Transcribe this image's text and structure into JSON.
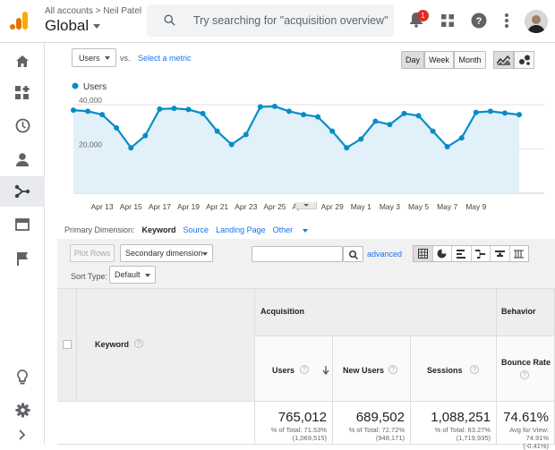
{
  "header": {
    "breadcrumb": "All accounts > Neil Patel",
    "property": "Global",
    "search_placeholder": "Try searching for \"acquisition overview\"",
    "notification_count": "1"
  },
  "sidebar": {
    "items": [
      "home-icon",
      "dashboard-icon",
      "realtime-icon",
      "audience-icon",
      "acquisition-icon",
      "behavior-icon",
      "conversions-icon",
      "discover-icon",
      "admin-icon",
      "expand-icon"
    ],
    "active": "acquisition-icon"
  },
  "controls": {
    "metric_select": "Users",
    "vs": "vs.",
    "select_metric": "Select a metric",
    "day": "Day",
    "week": "Week",
    "month": "Month"
  },
  "chart_data": {
    "type": "area",
    "series": [
      {
        "name": "Users",
        "values": [
          37500,
          37000,
          35500,
          29500,
          20500,
          26000,
          38000,
          38300,
          37800,
          36000,
          28000,
          22000,
          26500,
          39000,
          39200,
          37000,
          35500,
          34500,
          28000,
          20500,
          24500,
          32500,
          31000,
          36000,
          35000,
          28000,
          21000,
          25000,
          36500,
          37000,
          36200,
          35500
        ]
      }
    ],
    "x_tick_labels": [
      "Apr 13",
      "Apr 15",
      "Apr 17",
      "Apr 19",
      "Apr 21",
      "Apr 23",
      "Apr 25",
      "Apr 27",
      "Apr 29",
      "May 1",
      "May 3",
      "May 5",
      "May 7",
      "May 9"
    ],
    "y_tick_labels": [
      "40,000",
      "20,000"
    ],
    "ylim": [
      0,
      42000
    ],
    "color": "#058dc7",
    "fill": "#e1f0f9"
  },
  "dimensions": {
    "label": "Primary Dimension:",
    "keyword": "Keyword",
    "source": "Source",
    "landing": "Landing Page",
    "other": "Other"
  },
  "tools": {
    "plot_rows": "Plot Rows",
    "secondary": "Secondary dimension",
    "sort_type_label": "Sort Type:",
    "sort_value": "Default",
    "advanced": "advanced"
  },
  "table": {
    "keyword_header": "Keyword",
    "acquisition": "Acquisition",
    "behavior": "Behavior",
    "columns": [
      "Users",
      "New Users",
      "Sessions",
      "Bounce Rate"
    ],
    "totals": [
      {
        "value": "765,012",
        "line1": "% of Total: 71.53%",
        "line2": "(1,069,515)"
      },
      {
        "value": "689,502",
        "line1": "% of Total: 72.72%",
        "line2": "(948,171)"
      },
      {
        "value": "1,088,251",
        "line1": "% of Total: 63.27%",
        "line2": "(1,719,935)"
      },
      {
        "value": "74.61%",
        "line1": "Avg for View:",
        "line2": "74.91%",
        "line3": "(-0.41%)"
      }
    ]
  }
}
